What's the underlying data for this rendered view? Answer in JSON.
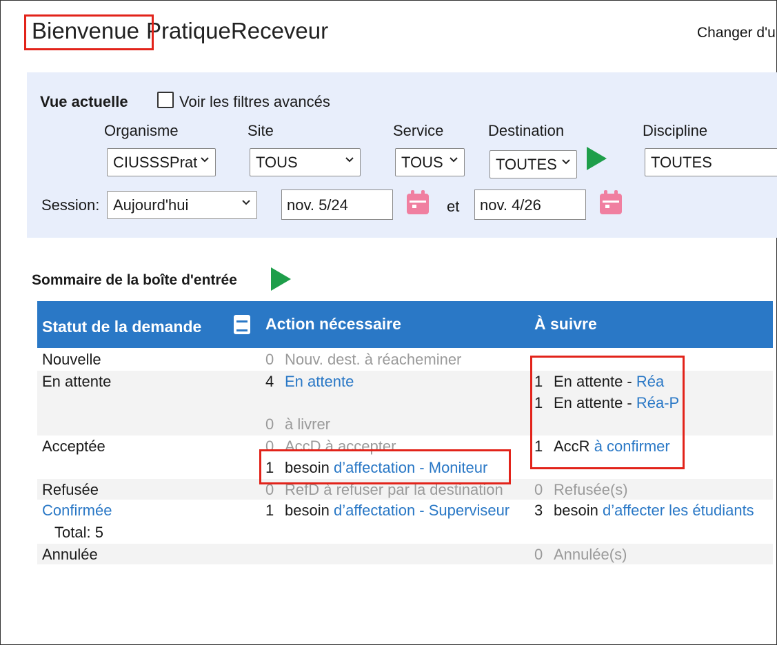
{
  "header": {
    "welcome": "Bienvenue",
    "user": "PratiqueReceveur",
    "change_link": "Changer d'u"
  },
  "filters": {
    "current_view_label": "Vue actuelle",
    "advanced_checkbox_label": "Voir les filtres avancés",
    "advanced_checked": false,
    "organisme_label": "Organisme",
    "organisme_value": "CIUSSSPrat",
    "site_label": "Site",
    "site_value": "TOUS",
    "service_label": "Service",
    "service_value": "TOUS",
    "destination_label": "Destination",
    "destination_value": "TOUTES",
    "discipline_label": "Discipline",
    "discipline_value": "TOUTES",
    "session_label": "Session:",
    "session_value": "Aujourd'hui",
    "date_from": "nov. 5/24",
    "between_label": "et",
    "date_to": "nov. 4/26"
  },
  "summary": {
    "title": "Sommaire de la boîte d'entrée",
    "col_status": "Statut de la demande",
    "col_action": "Action nécessaire",
    "col_follow": "À suivre",
    "rows": {
      "nouvelle": {
        "status": "Nouvelle",
        "action_count": "0",
        "action_text": "Nouv. dest. à réacheminer"
      },
      "attente": {
        "status": "En attente",
        "action_count": "4",
        "action_link": "En attente",
        "action2_count": "0",
        "action2_text": "à livrer",
        "follow1_count": "1",
        "follow1_text": "En attente - ",
        "follow1_link": "Réa",
        "follow2_count": "1",
        "follow2_text": "En attente - ",
        "follow2_link": "Réa-P"
      },
      "acceptee": {
        "status": "Acceptée",
        "action_count": "0",
        "action_text": "AccD à accepter",
        "action2_count": "1",
        "action2_text": "besoin ",
        "action2_link": "d’affectation - Moniteur",
        "follow_count": "1",
        "follow_text": "AccR ",
        "follow_link": "à confirmer"
      },
      "refusee": {
        "status": "Refusée",
        "action_count": "0",
        "action_text": "RefD à refuser par la destination",
        "follow_count": "0",
        "follow_text": "Refusée(s)"
      },
      "confirmee": {
        "status": "Confirmée",
        "total": "Total: 5",
        "action_count": "1",
        "action_text": "besoin ",
        "action_link": "d’affectation - Superviseur",
        "follow_count": "3",
        "follow_text": "besoin ",
        "follow_link": "d’affecter les étudiants"
      },
      "annulee": {
        "status": "Annulée",
        "follow_count": "0",
        "follow_text": "Annulée(s)"
      }
    }
  },
  "colors": {
    "header_blue": "#2a78c6",
    "filter_bg": "#e8eefb",
    "highlight_red": "#e2231a",
    "go_green": "#1e9e4a",
    "calendar_pink": "#f07fa0"
  }
}
